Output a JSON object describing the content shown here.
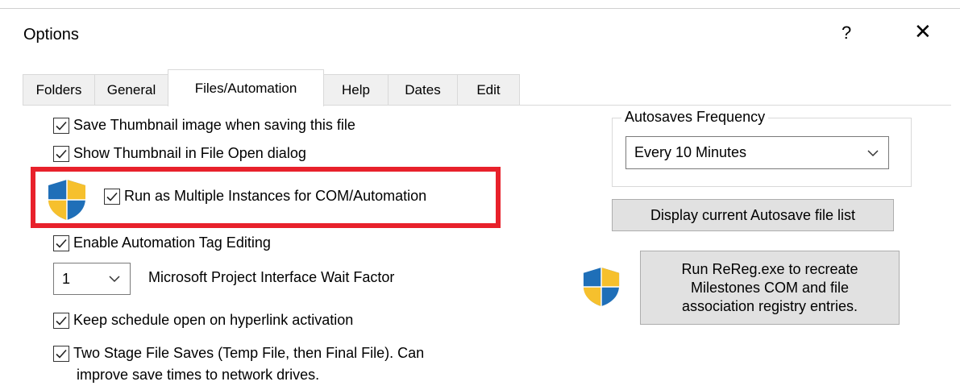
{
  "window": {
    "title": "Options",
    "help_label": "?",
    "close_label": "✕"
  },
  "tabs": [
    {
      "label": "Folders",
      "active": false
    },
    {
      "label": "General",
      "active": false
    },
    {
      "label": "Files/Automation",
      "active": true
    },
    {
      "label": "Help",
      "active": false
    },
    {
      "label": "Dates",
      "active": false
    },
    {
      "label": "Edit",
      "active": false
    }
  ],
  "options": {
    "save_thumbnail": {
      "label": "Save Thumbnail image when saving this file",
      "checked": true
    },
    "show_thumbnail": {
      "label": "Show Thumbnail in File Open dialog",
      "checked": true
    },
    "multiple_instances": {
      "label": "Run as Multiple Instances for COM/Automation",
      "checked": true
    },
    "automation_tag": {
      "label": "Enable Automation Tag Editing",
      "checked": true
    },
    "wait_factor": {
      "value": "1",
      "label": "Microsoft Project Interface Wait Factor"
    },
    "keep_open": {
      "label": "Keep schedule open on hyperlink activation",
      "checked": true
    },
    "two_stage": {
      "label_line1": "Two Stage File Saves (Temp File, then Final File). Can",
      "label_line2": "improve save times to network drives.",
      "checked": true
    }
  },
  "autosave": {
    "group_title": "Autosaves Frequency",
    "selected": "Every 10 Minutes",
    "display_button": "Display current Autosave file list"
  },
  "rereg": {
    "line1": "Run ReReg.exe to recreate",
    "line2": "Milestones COM and file",
    "line3": "association registry entries."
  },
  "colors": {
    "highlight": "#e8212b",
    "shield_blue": "#1f6fb8",
    "shield_yellow": "#f6c02d"
  }
}
